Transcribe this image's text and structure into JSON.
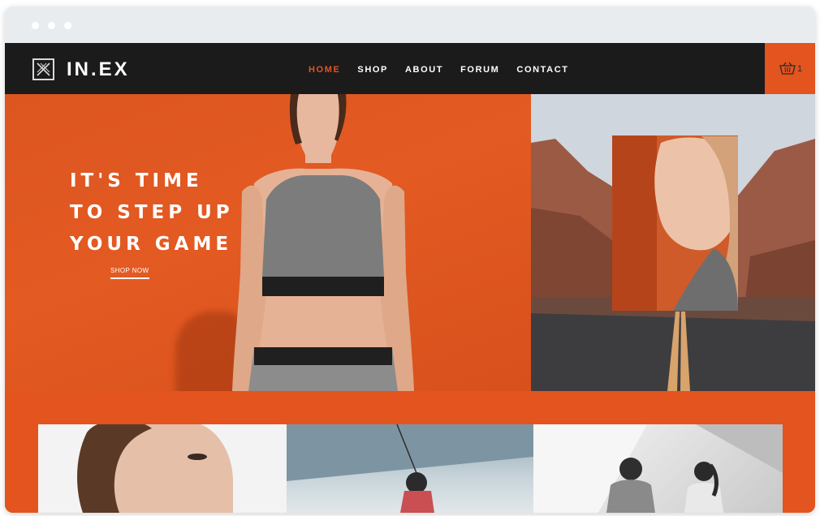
{
  "window": {
    "controls": [
      "close",
      "minimize",
      "maximize"
    ]
  },
  "brand": {
    "name": "IN.EX",
    "logo_icon": "x-monogram-icon"
  },
  "nav": {
    "items": [
      {
        "label": "HOME",
        "active": true
      },
      {
        "label": "SHOP",
        "active": false
      },
      {
        "label": "ABOUT",
        "active": false
      },
      {
        "label": "FORUM",
        "active": false
      },
      {
        "label": "CONTACT",
        "active": false
      }
    ]
  },
  "cart": {
    "icon": "basket-icon",
    "count": "1"
  },
  "hero": {
    "headline": [
      "IT'S TIME",
      "TO STEP UP",
      "YOUR GAME"
    ],
    "cta_label": "SHOP NOW"
  },
  "colors": {
    "accent": "#e3541f",
    "header_bg": "#1b1b1b",
    "text_light": "#ffffff"
  }
}
